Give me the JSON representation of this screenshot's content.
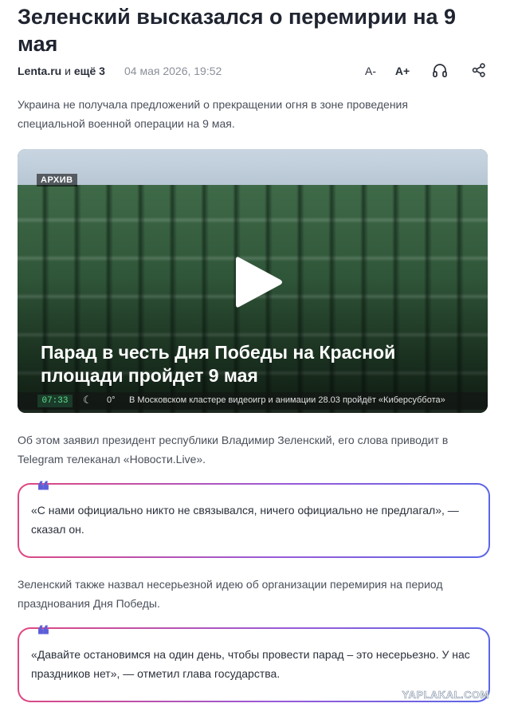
{
  "article": {
    "title": "Зеленский высказался о перемирии на 9 мая",
    "source_name": "Lenta.ru",
    "source_and": "и",
    "source_more": "ещё 3",
    "date": "04 мая 2026, 19:52",
    "lead": "Украина не получала предложений о прекращении огня в зоне проведения специальной военной операции на 9 мая."
  },
  "toolbar": {
    "font_decrease": "A-",
    "font_increase": "A+",
    "listen_icon": "headphones-icon",
    "share_icon": "share-icon"
  },
  "video": {
    "badge": "АРХИВ",
    "caption": "Парад в честь Дня Победы на Красной площади пройдет 9 мая",
    "ticker_time": "07:33",
    "ticker_temp": "0°",
    "ticker_text": "В Московском кластере видеоигр и анимации 28.03 пройдёт «Киберсуббота»",
    "play_icon": "play-icon"
  },
  "body": {
    "para1": "Об этом заявил президент республики Владимир Зеленский, его слова приводит в Telegram телеканал «Новости.Live».",
    "quote1": "«С нами официально никто не связывался, ничего официально не предлагал», — сказал он.",
    "para2": "Зеленский также назвал несерьезной идею об организации перемирия на период празднования Дня Победы.",
    "quote2": "«Давайте остановимся на один день, чтобы провести парад – это несерьезно. У нас праздников нет», — отметил глава государства.",
    "quote_mark": "❝"
  },
  "watermark": "YAPLAKAL.COM",
  "colors": {
    "quote_gradient_start": "#e0487e",
    "quote_gradient_end": "#5b66e6",
    "quote_mark": "#5b5ed8"
  }
}
